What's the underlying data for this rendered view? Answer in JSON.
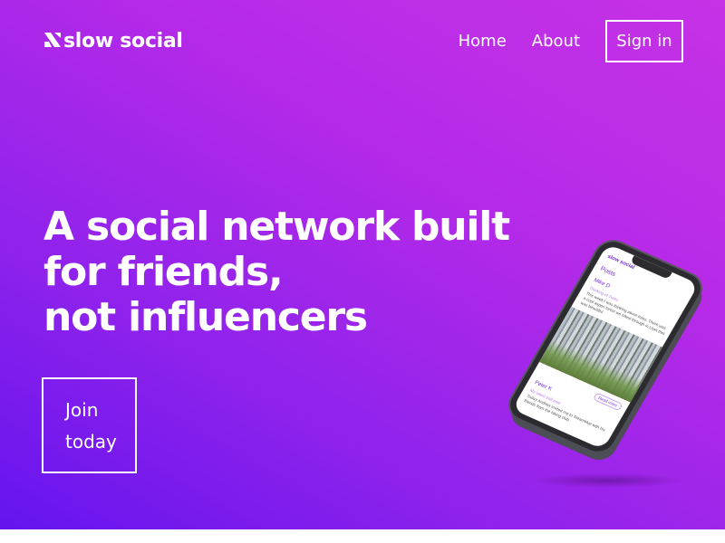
{
  "brand": {
    "name": "slow social",
    "logo_icon": "slash-logo-icon"
  },
  "nav": {
    "home": "Home",
    "about": "About",
    "signin": "Sign in"
  },
  "hero": {
    "headline_lines": [
      "A social network built",
      "for friends,",
      "not influencers"
    ],
    "cta_lines": [
      "Join",
      "today"
    ]
  },
  "phone_screen": {
    "app_name": "slow social",
    "section_title": "Posts",
    "post1_author": "Mike D",
    "post1_subtitle": "Thinking of Trees",
    "post1_text": "This week I was thinking about trees. There was a cool aspen forest we hiked through in Utah that was beautiful.",
    "read_more": "Read more",
    "post2_author": "Peter K",
    "post2_subtitle": "My latest trail post",
    "post2_text": "Today Andrew invited me to Steamblue with his friends from the hiking club."
  },
  "colors": {
    "gradient_start": "#c632e6",
    "gradient_end": "#6514ee",
    "accent": "#7a2ee0",
    "text": "#ffffff"
  }
}
